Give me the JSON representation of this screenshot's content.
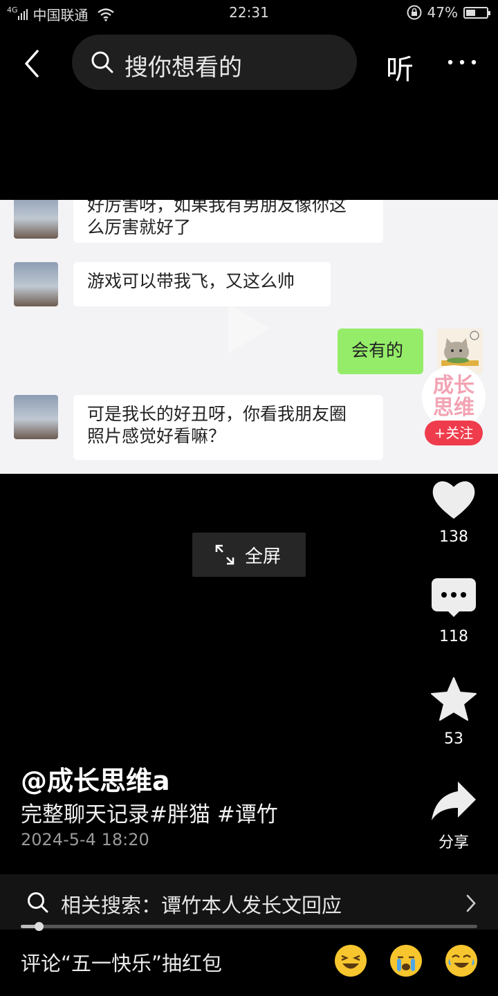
{
  "status": {
    "network": "4G",
    "carrier": "中国联通",
    "time": "22:31",
    "battery_text": "47%",
    "battery_level": 0.47
  },
  "nav": {
    "search_placeholder": "搜你想看的",
    "listen_label": "听"
  },
  "chat": {
    "msg1": "好厉害呀，如果我有男朋友像你这\n么厉害就好了",
    "msg2": "游戏可以带我飞，又这么帅",
    "msg3": "会有的",
    "msg4": "可是我长的好丑呀，你看我朋友圈\n照片感觉好看嘛？"
  },
  "author_avatar_text": "成长\n思维",
  "follow_label": "+关注",
  "fullscreen_label": "全屏",
  "actions": {
    "likes": "138",
    "comments": "118",
    "favorites": "53",
    "share_label": "分享"
  },
  "post": {
    "author": "@成长思维a",
    "description": "完整聊天记录#胖猫 #谭竹",
    "date": "2024-5-4 18:20"
  },
  "related": {
    "text": "相关搜索：谭竹本人发长文回应"
  },
  "progress": {
    "fraction": 0.04
  },
  "comment_prompt": "评论“五一快乐”抽红包",
  "icons": [
    "signal-icon",
    "wifi-icon",
    "lock-icon",
    "battery-icon",
    "back-icon",
    "search-icon",
    "more-icon",
    "heart-icon",
    "comment-icon",
    "star-icon",
    "share-icon",
    "expand-icon",
    "chevron-right-icon",
    "emoji-laugh-icon",
    "emoji-cry-icon",
    "emoji-tears-icon"
  ]
}
